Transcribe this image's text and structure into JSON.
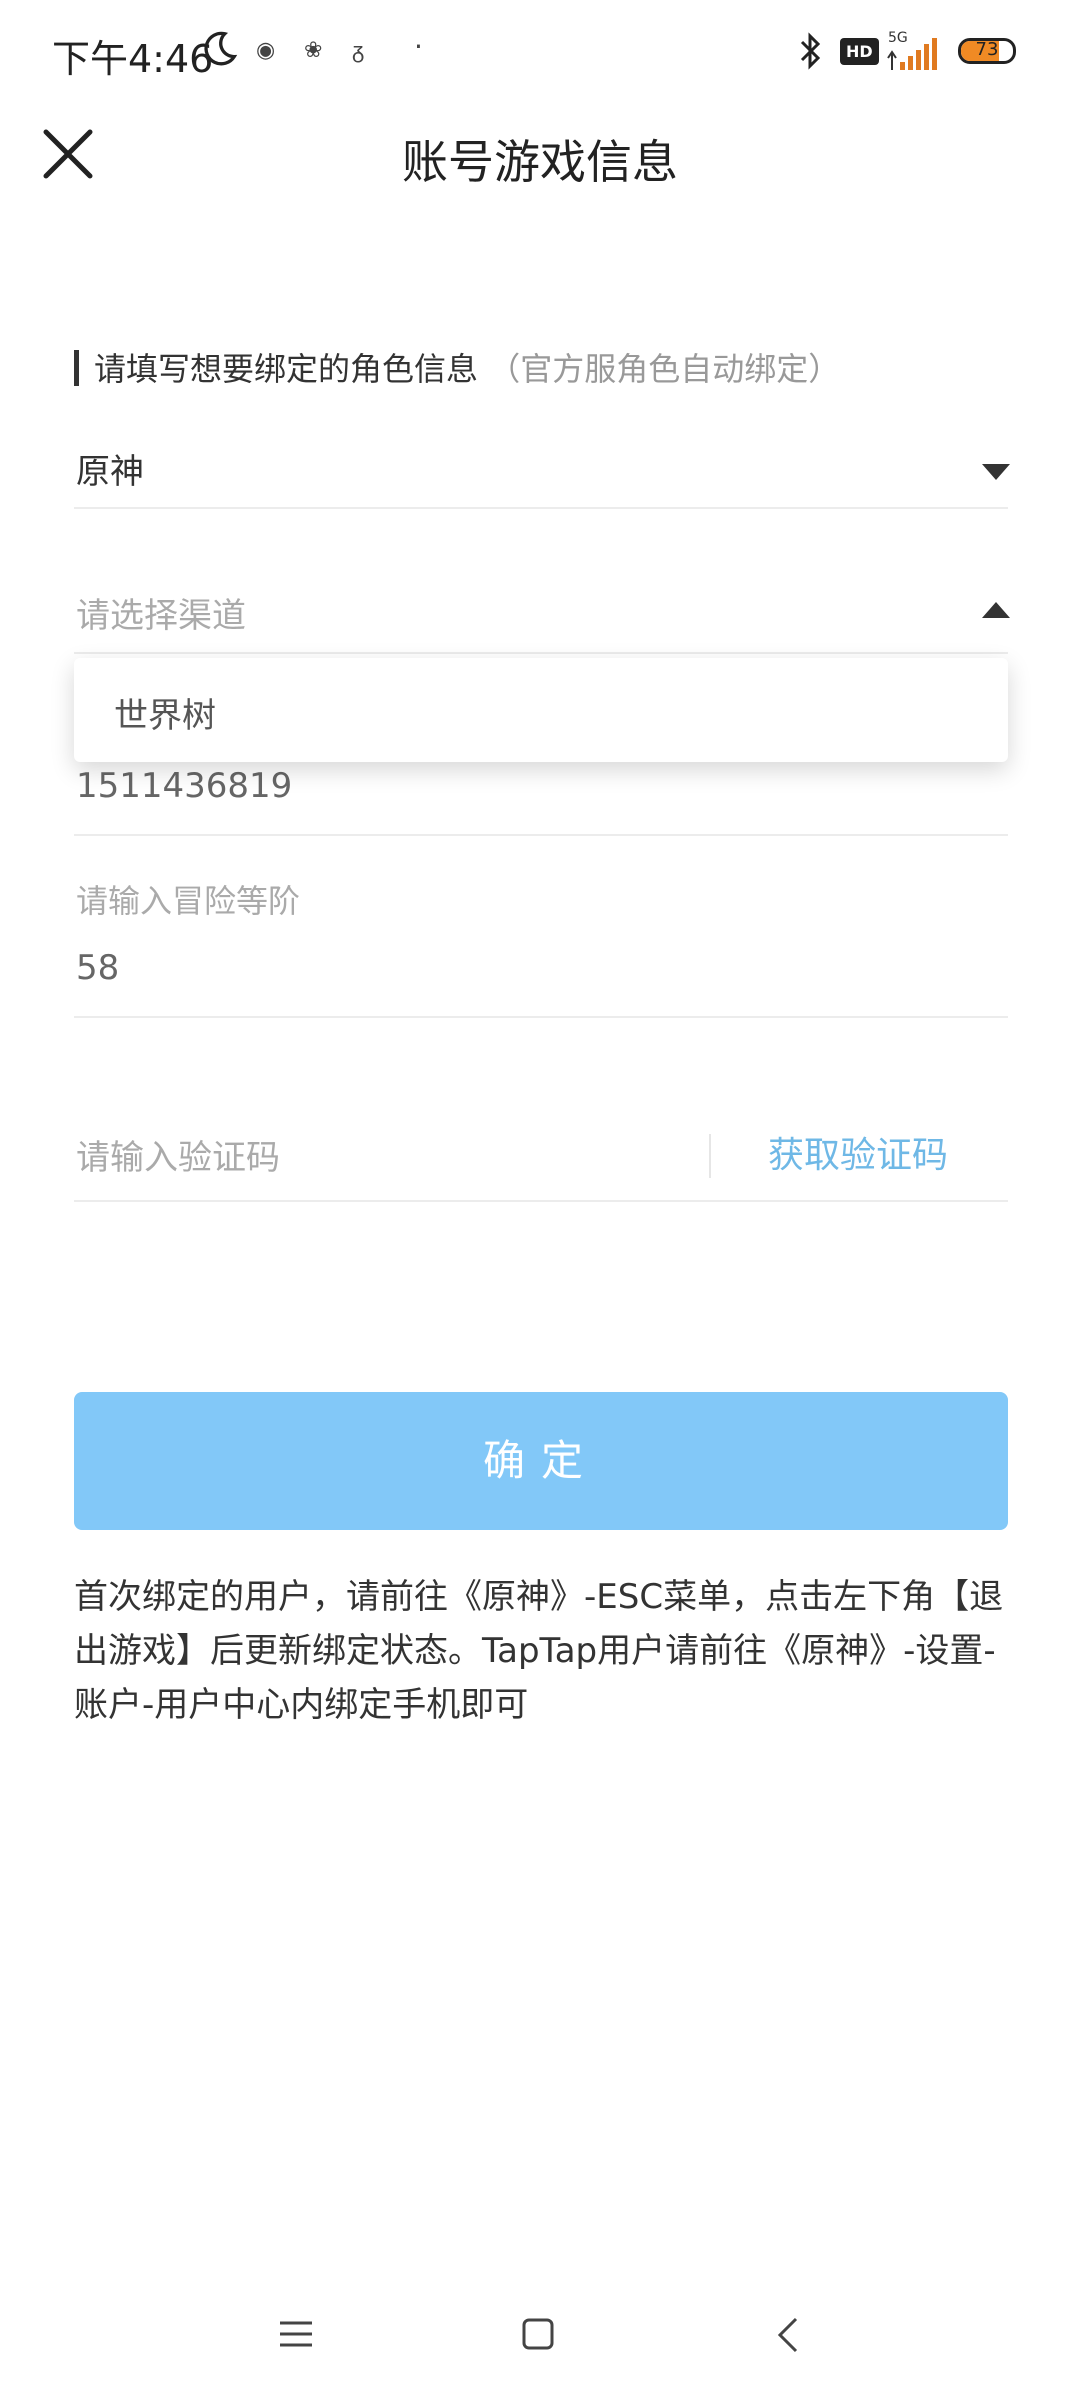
{
  "status_bar": {
    "time": "下午4:46",
    "network": "5G",
    "hd": "HD",
    "battery": "73",
    "battery_level": 0.73,
    "notification_icons": [
      "weibo-icon",
      "qq-icon",
      "app-icon",
      "dot-icon"
    ]
  },
  "header": {
    "title": "账号游戏信息"
  },
  "section": {
    "label": "请填写想要绑定的角色信息",
    "hint": "（官方服角色自动绑定）"
  },
  "game_select": {
    "value": "原神"
  },
  "channel_select": {
    "placeholder": "请选择渠道",
    "dropdown_options": [
      "世界树"
    ]
  },
  "uid_field": {
    "value": "1511436819"
  },
  "level_field": {
    "label": "请输入冒险等阶",
    "value": "58"
  },
  "code_field": {
    "placeholder": "请输入验证码",
    "button": "获取验证码"
  },
  "confirm_button": {
    "label": "确定"
  },
  "note": "首次绑定的用户，请前往《原神》-ESC菜单，点击左下角【退出游戏】后更新绑定状态。TapTap用户请前往《原神》-设置-账户-用户中心内绑定手机即可",
  "colors": {
    "accent": "#82c8f8",
    "link": "#6fb8e6",
    "battery": "#f08a24"
  }
}
